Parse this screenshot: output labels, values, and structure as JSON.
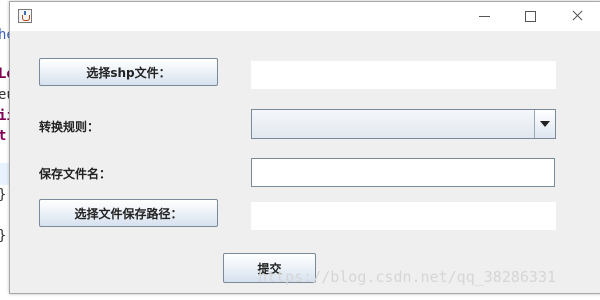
{
  "background_editor": {
    "lines": [
      {
        "text": "he",
        "color": "#3d5fc0"
      },
      {
        "text": "Lo",
        "color": "#7f0055"
      },
      {
        "text": "eu",
        "color": "#333333"
      },
      {
        "text": "ii",
        "color": "#7f0055"
      },
      {
        "text": "t",
        "color": "#7f0055"
      },
      {
        "text": "}",
        "color": "#333333"
      },
      {
        "text": "}",
        "color": "#333333"
      }
    ]
  },
  "window": {
    "title": "",
    "icon": "java-cup-icon",
    "controls": {
      "minimize": "—",
      "maximize": "☐",
      "close": "✕"
    }
  },
  "form": {
    "choose_shp_button": "选择shp文件：",
    "shp_path_value": "",
    "rule_label": "转换规则：",
    "rule_selected": "",
    "save_name_label": "保存文件名：",
    "save_name_value": "",
    "choose_save_path_button": "选择文件保存路径：",
    "save_path_value": "",
    "submit_button": "提交"
  },
  "watermark": "https://blog.csdn.net/qq_38286331",
  "colors": {
    "window_bg": "#efefef",
    "button_border": "#7a8a99",
    "accent": "#3d6fb3"
  }
}
